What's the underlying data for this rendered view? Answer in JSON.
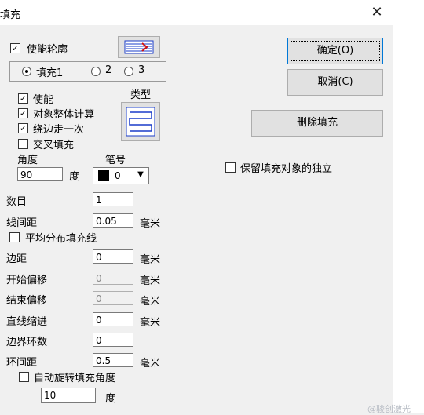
{
  "window": {
    "title": "填充",
    "close_glyph": "✕"
  },
  "left": {
    "enable_outline": {
      "label": "使能轮廓",
      "checked": true
    },
    "fill_select": {
      "options": [
        "填充1",
        "2",
        "3"
      ],
      "selected": "填充1"
    },
    "enable": {
      "label": "使能",
      "checked": true
    },
    "whole_calc": {
      "label": "对象整体计算",
      "checked": true
    },
    "edge_once": {
      "label": "绕边走一次",
      "checked": true
    },
    "cross_fill": {
      "label": "交叉填充",
      "checked": false
    },
    "type_label": "类型",
    "angle_label": "角度",
    "angle_value": "90",
    "angle_unit": "度",
    "pen_label": "笔号",
    "pen_value": "0",
    "pen_color": "#000000",
    "count_label": "数目",
    "count_value": "1",
    "line_spacing_label": "线间距",
    "line_spacing_value": "0.05",
    "unit_mm": "毫米",
    "avg_distribute": {
      "label": "平均分布填充线",
      "checked": false
    },
    "margin_label": "边距",
    "margin_value": "0",
    "start_offset_label": "开始偏移",
    "start_offset_value": "0",
    "end_offset_label": "结束偏移",
    "end_offset_value": "0",
    "line_indent_label": "直线缩进",
    "line_indent_value": "0",
    "border_loops_label": "边界环数",
    "border_loops_value": "0",
    "loop_spacing_label": "环间距",
    "loop_spacing_value": "0.5",
    "auto_rotate": {
      "label": "自动旋转填充角度",
      "checked": false
    },
    "rotate_value": "10",
    "rotate_unit": "度"
  },
  "right": {
    "ok_label": "确定(O)",
    "cancel_label": "取消(C)",
    "delete_fill_label": "删除填充",
    "keep_independent": {
      "label": "保留填充对象的独立",
      "checked": false
    }
  },
  "watermark": "@骏创激光",
  "colors": {
    "accent": "#0078d7",
    "dialog_bg": "#f0f0f0",
    "icon_blue": "#1a3cc8",
    "icon_red": "#d01010"
  }
}
